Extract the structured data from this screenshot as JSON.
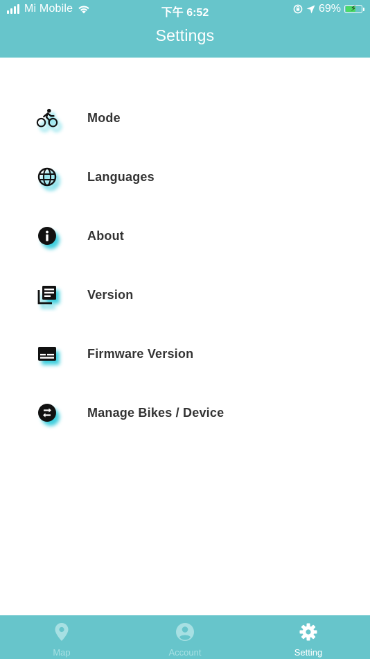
{
  "status_bar": {
    "carrier": "Mi Mobile",
    "time": "下午 6:52",
    "battery_percent": "69%",
    "battery_level": 0.69,
    "icons": [
      "signal-icon",
      "wifi-icon",
      "orientation-lock-icon",
      "location-arrow-icon",
      "battery-charging-icon"
    ]
  },
  "header": {
    "title": "Settings"
  },
  "menu": {
    "items": [
      {
        "label": "Mode",
        "icon": "bicycle-icon"
      },
      {
        "label": "Languages",
        "icon": "globe-icon"
      },
      {
        "label": "About",
        "icon": "info-icon"
      },
      {
        "label": "Version",
        "icon": "library-books-icon"
      },
      {
        "label": "Firmware Version",
        "icon": "subtitles-icon"
      },
      {
        "label": "Manage Bikes / Device",
        "icon": "swap-arrows-icon"
      }
    ]
  },
  "tab_bar": {
    "tabs": [
      {
        "label": "Map",
        "icon": "map-pin-icon",
        "active": false
      },
      {
        "label": "Account",
        "icon": "account-circle-icon",
        "active": false
      },
      {
        "label": "Setting",
        "icon": "gear-icon",
        "active": true
      }
    ]
  },
  "colors": {
    "primary": "#67c5cb",
    "icon_shadow": "#00bed2",
    "text": "#333333",
    "tab_inactive": "#a7e0e3",
    "tab_active": "#ffffff"
  }
}
